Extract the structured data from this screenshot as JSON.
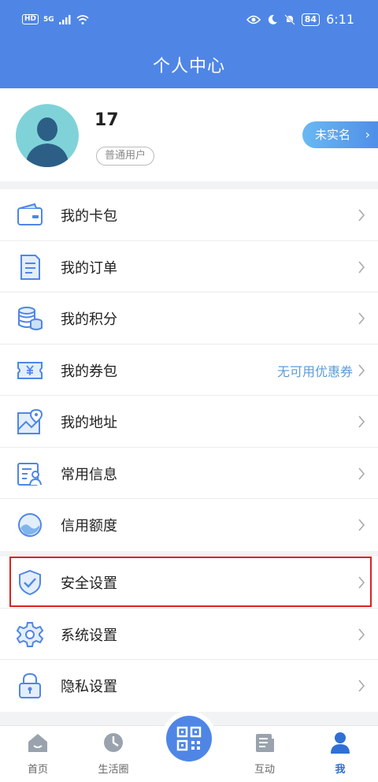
{
  "status_bar": {
    "left_labels": [
      "HD",
      "5G"
    ],
    "battery": "84",
    "time": "6:11"
  },
  "header": {
    "title": "个人中心"
  },
  "profile": {
    "username": "17",
    "user_type": "普通用户",
    "verify_label": "未实名",
    "verify_chevron": "›"
  },
  "menu_group_1": [
    {
      "label": "我的卡包",
      "icon": "wallet-icon"
    },
    {
      "label": "我的订单",
      "icon": "document-icon"
    },
    {
      "label": "我的积分",
      "icon": "coins-icon"
    },
    {
      "label": "我的券包",
      "icon": "coupon-icon",
      "value": "无可用优惠券"
    },
    {
      "label": "我的地址",
      "icon": "map-pin-icon"
    },
    {
      "label": "常用信息",
      "icon": "contact-card-icon"
    },
    {
      "label": "信用额度",
      "icon": "credit-gauge-icon"
    }
  ],
  "menu_group_2": [
    {
      "label": "安全设置",
      "icon": "shield-check-icon"
    },
    {
      "label": "系统设置",
      "icon": "gear-icon"
    },
    {
      "label": "隐私设置",
      "icon": "lock-icon"
    }
  ],
  "tab_bar": [
    {
      "label": "首页",
      "icon": "home-icon"
    },
    {
      "label": "生活圈",
      "icon": "life-circle-icon"
    },
    {
      "label": "",
      "icon": "qr-code-icon"
    },
    {
      "label": "互动",
      "icon": "news-icon"
    },
    {
      "label": "我",
      "icon": "user-icon",
      "active": true
    }
  ],
  "colors": {
    "primary": "#4f86e6",
    "accent_text": "#5b9bd8",
    "highlight_border": "#e02020"
  }
}
